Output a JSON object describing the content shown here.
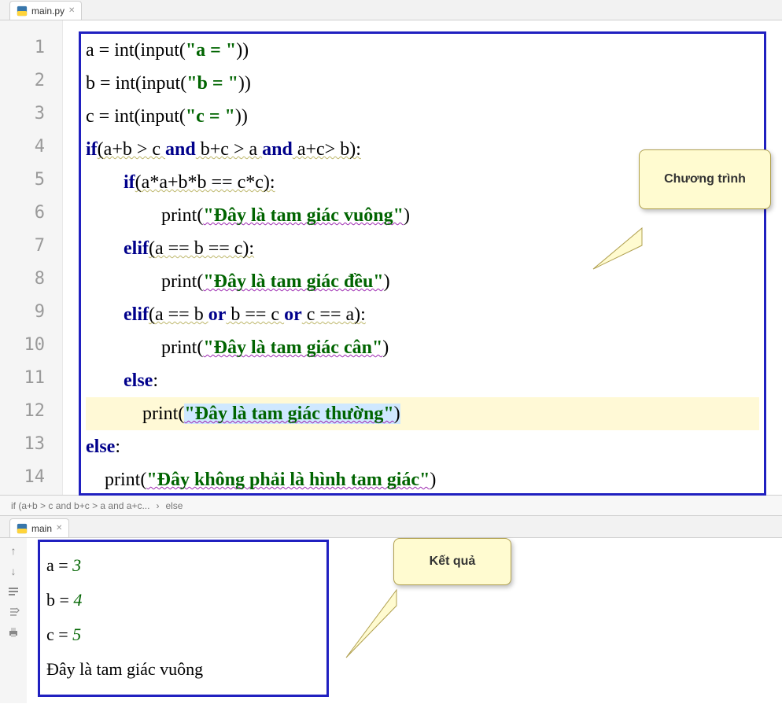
{
  "tabs": {
    "editor": "main.py",
    "console": "main"
  },
  "gutter": [
    "1",
    "2",
    "3",
    "4",
    "5",
    "6",
    "7",
    "8",
    "9",
    "10",
    "11",
    "12",
    "13",
    "14"
  ],
  "code": {
    "l1": {
      "a": "a = ",
      "b": "int",
      "c": "(input(",
      "d": "\"a = \"",
      "e": "))"
    },
    "l2": {
      "a": "b = ",
      "b": "int",
      "c": "(input(",
      "d": "\"b = \"",
      "e": "))"
    },
    "l3": {
      "a": "c = ",
      "b": "int",
      "c": "(input(",
      "d": "\"c = \"",
      "e": "))"
    },
    "l4": {
      "a": "if",
      "b": "(a+b > c ",
      "c": "and",
      "d": " b+c > a ",
      "e": "and",
      "f": " a+c> b):"
    },
    "l5": {
      "a": "        ",
      "b": "if",
      "c": "(a*a+b*b == c*c):"
    },
    "l6": {
      "a": "                print(",
      "b": "\"Đây là tam giác vuông\"",
      "c": ")"
    },
    "l7": {
      "a": "        ",
      "b": "elif",
      "c": "(a == b == c):"
    },
    "l8": {
      "a": "                print(",
      "b": "\"Đây là tam giác đều\"",
      "c": ")"
    },
    "l9": {
      "a": "        ",
      "b": "elif",
      "c": "(a == b ",
      "d": "or",
      "e": " b == c ",
      "f": "or",
      "g": " c == a):"
    },
    "l10": {
      "a": "                print(",
      "b": "\"Đây là tam giác cân\"",
      "c": ")"
    },
    "l11": {
      "a": "        ",
      "b": "else",
      "c": ":"
    },
    "l12": {
      "a": "            print(",
      "b": "\"Đây là tam giác thường\"",
      "c": ")"
    },
    "l13": {
      "a": "else",
      "b": ":"
    },
    "l14": {
      "a": "    print(",
      "b": "\"Đây không phải là hình tam giác\"",
      "c": ")"
    }
  },
  "breadcrumb": {
    "part1": "if (a+b > c and b+c > a and a+c...",
    "sep": "›",
    "part2": "else"
  },
  "output": {
    "l1": {
      "a": "a = ",
      "b": "3"
    },
    "l2": {
      "a": "b = ",
      "b": "4"
    },
    "l3": {
      "a": "c = ",
      "b": "5"
    },
    "l4": "Đây là tam giác vuông"
  },
  "callouts": {
    "program": "Chương trình",
    "result": "Kết quả"
  }
}
